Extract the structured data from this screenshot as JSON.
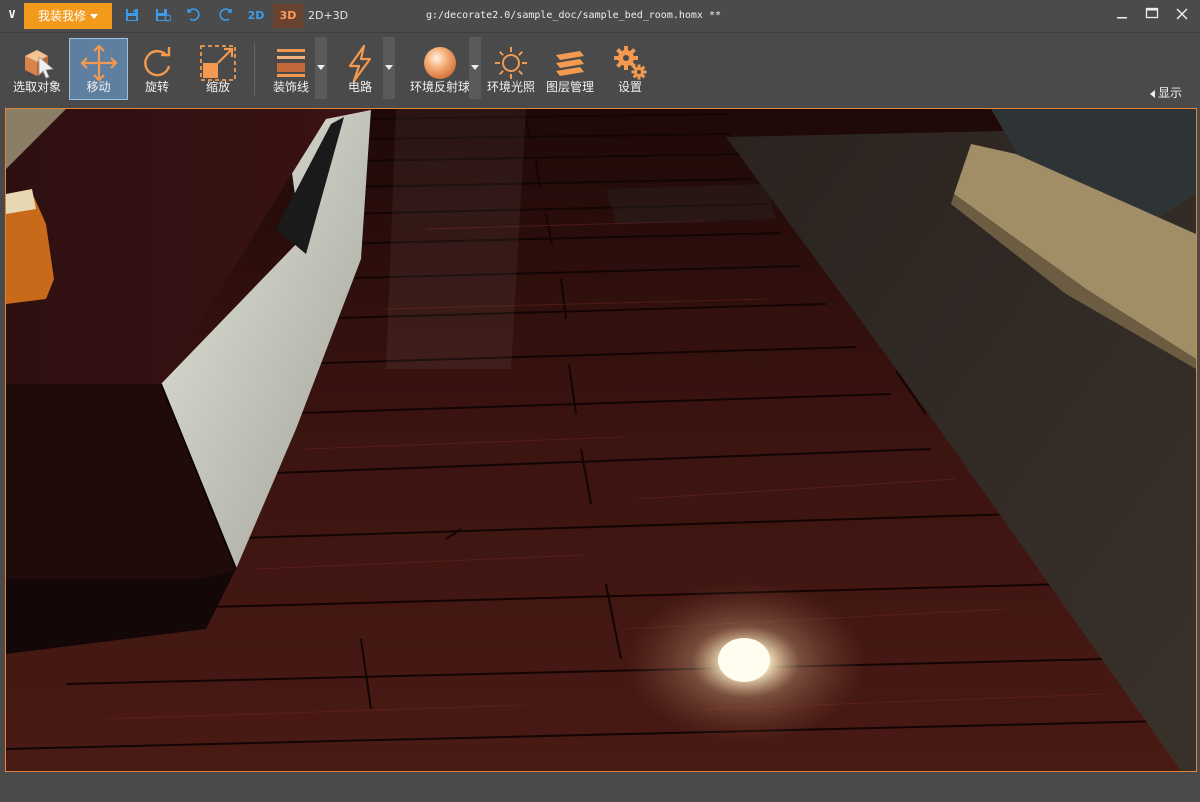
{
  "titlebar": {
    "app_icon": "V",
    "menu_label": "我装我修",
    "view_2d": "2D",
    "view_3d": "3D",
    "view_2d3d": "2D+3D",
    "file_title": "g:/decorate2.0/sample_doc/sample_bed_room.homx **",
    "icons": [
      "save-icon",
      "save-as-icon",
      "undo-icon",
      "redo-icon",
      "minimize-icon",
      "maximize-icon",
      "close-icon"
    ]
  },
  "toolbar": {
    "items": [
      {
        "label": "选取对象",
        "icon": "select-cube-icon"
      },
      {
        "label": "移动",
        "icon": "move-arrows-icon",
        "active": true
      },
      {
        "label": "旋转",
        "icon": "rotate-icon"
      },
      {
        "label": "缩放",
        "icon": "scale-icon"
      },
      {
        "label": "装饰线",
        "icon": "molding-lines-icon"
      },
      {
        "label": "电路",
        "icon": "lightning-icon"
      },
      {
        "label": "环境反射球",
        "icon": "reflection-sphere-icon"
      },
      {
        "label": "环境光照",
        "icon": "sun-icon"
      },
      {
        "label": "图层管理",
        "icon": "layers-icon"
      },
      {
        "label": "设置",
        "icon": "gears-icon"
      }
    ],
    "show_label": "显示"
  },
  "colors": {
    "accent": "#f39a1c",
    "active_tool": "#5f7fa1",
    "viewport_border": "#e0843a",
    "tab_3d_text": "#ff9b59",
    "icon_blue": "#3d9be9"
  }
}
